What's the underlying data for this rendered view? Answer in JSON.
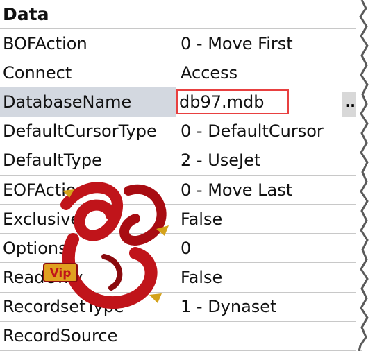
{
  "header": {
    "section_label": "Data"
  },
  "properties": [
    {
      "name": "BOFAction",
      "value": "0 - Move First"
    },
    {
      "name": "Connect",
      "value": "Access"
    },
    {
      "name": "DatabaseName",
      "value": "db97.mdb"
    },
    {
      "name": "DefaultCursorType",
      "value": "0 - DefaultCursor"
    },
    {
      "name": "DefaultType",
      "value": "2 - UseJet"
    },
    {
      "name": "EOFAction",
      "value": "0 - Move Last"
    },
    {
      "name": "Exclusive",
      "value": "False"
    },
    {
      "name": "Options",
      "value": "0"
    },
    {
      "name": "ReadOnly",
      "value": "False"
    },
    {
      "name": "RecordsetType",
      "value": "1 - Dynaset"
    },
    {
      "name": "RecordSource",
      "value": ""
    }
  ],
  "editor": {
    "ellipsis_label": "..."
  },
  "watermark": {
    "text": "Vip"
  },
  "colors": {
    "selected_row": "#d3d8e0",
    "editor_border": "#e84040",
    "logo_red": "#c0141a"
  }
}
